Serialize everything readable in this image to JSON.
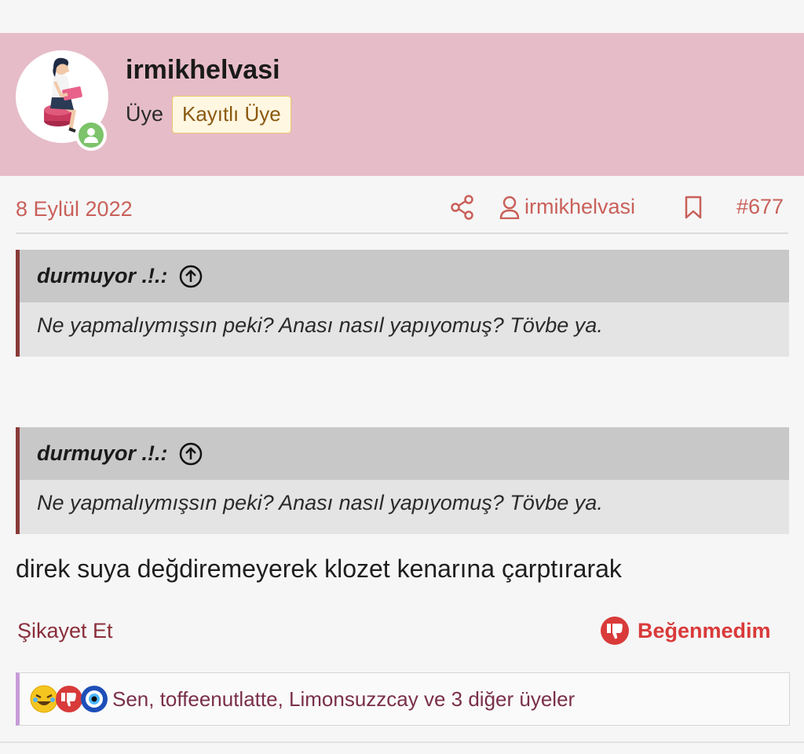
{
  "user": {
    "name": "irmikhelvasi",
    "role": "Üye",
    "badge": "Kayıtlı Üye"
  },
  "meta": {
    "date": "8 Eylül 2022",
    "author": "irmikhelvasi",
    "post_number": "#677"
  },
  "quotes": [
    {
      "author": "durmuyor .!.:",
      "text": "Ne yapmalıymışsın peki? Anası nasıl yapıyomuş? Tövbe ya."
    },
    {
      "author": "durmuyor .!.:",
      "text": "Ne yapmalıymışsın peki? Anası nasıl yapıyomuş? Tövbe ya."
    }
  ],
  "post_text": "direk suya değdiremeyerek klozet kenarına çarptırarak",
  "actions": {
    "report": "Şikayet Et",
    "dislike": "Beğenmedim"
  },
  "reactions": {
    "icons": [
      "laughing-emoji-icon",
      "thumbs-down-icon",
      "evil-eye-icon"
    ],
    "summary": "Sen, toffeenutlatte, Limonsuzzcay ve 3 diğer üyeler"
  },
  "colors": {
    "header_bg": "#e6bcc8",
    "accent_text": "#c9605a",
    "quote_border": "#8a3b39",
    "dislike": "#d93a3a",
    "badge_bg": "#fff7e2",
    "badge_border": "#f0c869",
    "online": "#7cc36a"
  }
}
